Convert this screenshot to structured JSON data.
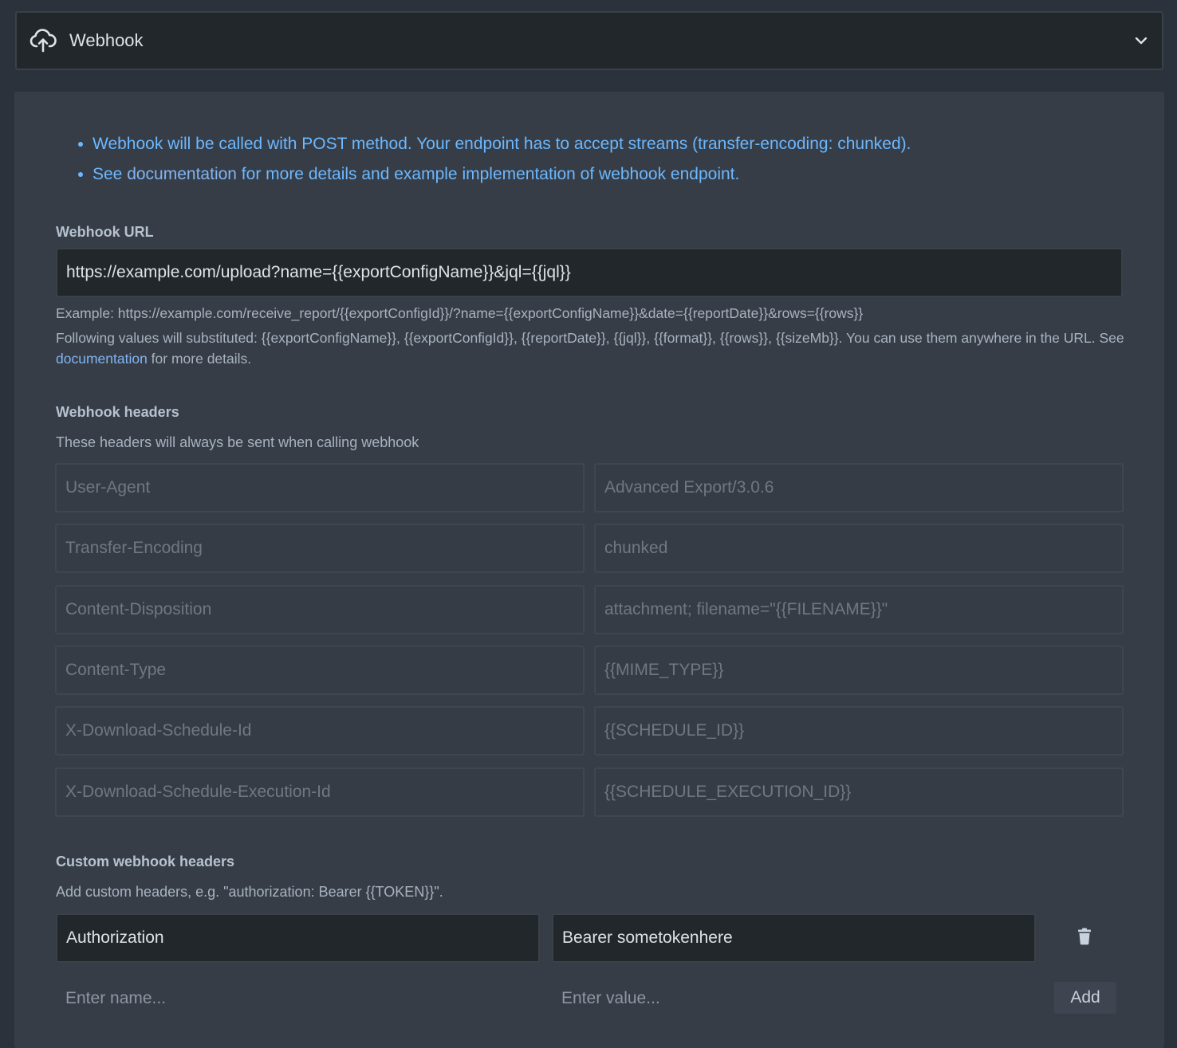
{
  "header": {
    "icon": "cloud-upload-icon",
    "title": "Webhook",
    "toggle_icon": "chevron-down-icon"
  },
  "notes": {
    "line1": "Webhook will be called with POST method. Your endpoint has to accept streams (transfer-encoding: chunked).",
    "line2_prefix": "See ",
    "line2_link": "documentation",
    "line2_suffix": " for more details and example implementation of webhook endpoint."
  },
  "webhook_url": {
    "label": "Webhook URL",
    "value": "https://example.com/upload?name={{exportConfigName}}&jql={{jql}}",
    "example": "Example: https://example.com/receive_report/{{exportConfigId}}/?name={{exportConfigName}}&date={{reportDate}}&rows={{rows}}",
    "help_prefix": "Following values will substituted: {{exportConfigName}}, {{exportConfigId}}, {{reportDate}}, {{jql}}, {{format}}, {{rows}}, {{sizeMb}}. You can use them anywhere in the URL. See ",
    "help_link": "documentation",
    "help_suffix": " for more details."
  },
  "webhook_headers": {
    "label": "Webhook headers",
    "description": "These headers will always be sent when calling webhook",
    "rows": [
      {
        "name": "User-Agent",
        "value": "Advanced Export/3.0.6"
      },
      {
        "name": "Transfer-Encoding",
        "value": "chunked"
      },
      {
        "name": "Content-Disposition",
        "value": "attachment; filename=\"{{FILENAME}}\""
      },
      {
        "name": "Content-Type",
        "value": "{{MIME_TYPE}}"
      },
      {
        "name": "X-Download-Schedule-Id",
        "value": "{{SCHEDULE_ID}}"
      },
      {
        "name": "X-Download-Schedule-Execution-Id",
        "value": "{{SCHEDULE_EXECUTION_ID}}"
      }
    ]
  },
  "custom_headers": {
    "label": "Custom webhook headers",
    "description": "Add custom headers, e.g. \"authorization: Bearer {{TOKEN}}\".",
    "rows": [
      {
        "name": "Authorization",
        "value": "Bearer sometokenhere"
      }
    ],
    "delete_icon": "trash-icon",
    "name_placeholder": "Enter name...",
    "value_placeholder": "Enter value...",
    "add_label": "Add"
  }
}
